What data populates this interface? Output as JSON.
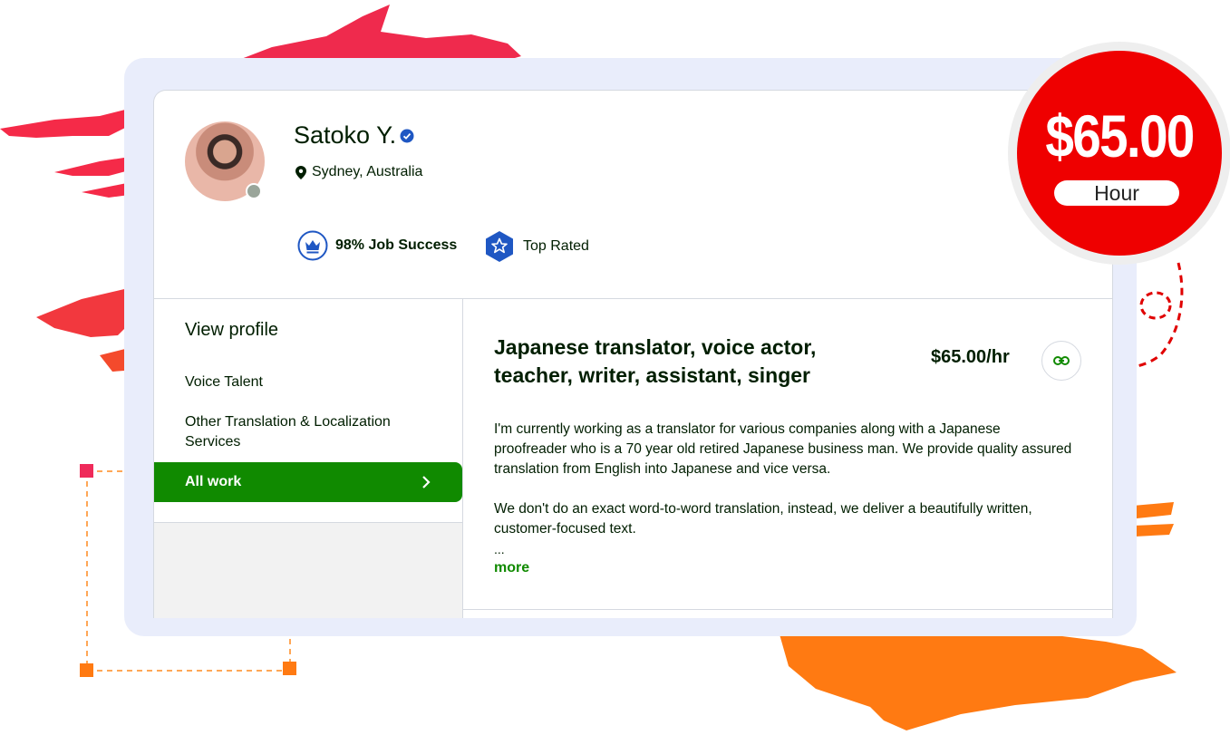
{
  "profile": {
    "name": "Satoko Y.",
    "location": "Sydney, Australia",
    "job_success": "98% Job Success",
    "top_rated": "Top Rated"
  },
  "sidebar": {
    "title": "View profile",
    "items": [
      {
        "label": "Voice Talent"
      },
      {
        "label": "Other Translation & Localization Services"
      }
    ],
    "active_label": "All work"
  },
  "main": {
    "title": "Japanese translator, voice actor, teacher, writer, assistant, singer",
    "rate": "$65.00/hr",
    "paragraph1": "I'm currently working as a translator for various companies along with a Japanese proofreader who is a 70 year old retired Japanese business man. We provide quality assured translation from English into Japanese and vice versa.",
    "paragraph2": "We don't do an exact word-to-word translation, instead, we deliver a beautifully written, customer-focused text.",
    "ellipsis": "...",
    "more": "more"
  },
  "price_badge": {
    "value": "$65.00",
    "unit": "Hour"
  },
  "colors": {
    "brand_green": "#108a00",
    "badge_red": "#ef0000",
    "frame_blue": "#e9edfb",
    "verified_blue": "#1f57c3"
  },
  "icons": [
    "location-pin-icon",
    "verified-icon",
    "crown-icon",
    "star-badge-icon",
    "chevron-right-icon",
    "link-icon"
  ]
}
